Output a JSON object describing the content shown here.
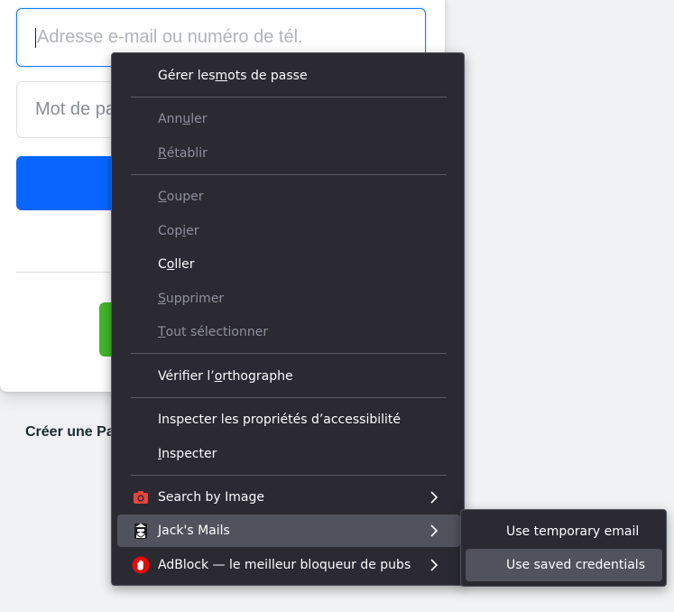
{
  "login": {
    "email_placeholder": "Adresse e-mail ou numéro de tél.",
    "password_placeholder": "Mot de passe",
    "create_page_text": "Créer une Page"
  },
  "context_menu": {
    "manage_passwords": {
      "pre": "Gérer les ",
      "key": "m",
      "post": "ots de passe"
    },
    "undo": {
      "pre": "Ann",
      "key": "u",
      "post": "ler"
    },
    "redo": {
      "pre": "",
      "key": "R",
      "post": "établir"
    },
    "cut": {
      "pre": "",
      "key": "C",
      "post": "ouper"
    },
    "copy": {
      "pre": "Cop",
      "key": "i",
      "post": "er"
    },
    "paste": {
      "pre": "C",
      "key": "o",
      "post": "ller"
    },
    "delete": {
      "pre": "",
      "key": "S",
      "post": "upprimer"
    },
    "select_all": {
      "pre": "",
      "key": "T",
      "post": "out sélectionner"
    },
    "spellcheck": {
      "pre": "Vérifier l’",
      "key": "o",
      "post": "rthographe"
    },
    "inspect_accessibility": "Inspecter les propriétés d’accessibilité",
    "inspect": {
      "pre": "",
      "key": "I",
      "post": "nspecter"
    },
    "search_by_image": "Search by Image",
    "jacks_mails": "Jack's Mails",
    "adblock": "AdBlock — le meilleur bloqueur de pubs"
  },
  "submenu": {
    "temp_email": "Use temporary email",
    "saved_credentials": "Use saved credentials"
  },
  "colors": {
    "menu_bg": "#2b2a33",
    "hover_bg": "#52525e",
    "facebook_blue": "#0866ff",
    "create_green": "#42b72a"
  }
}
